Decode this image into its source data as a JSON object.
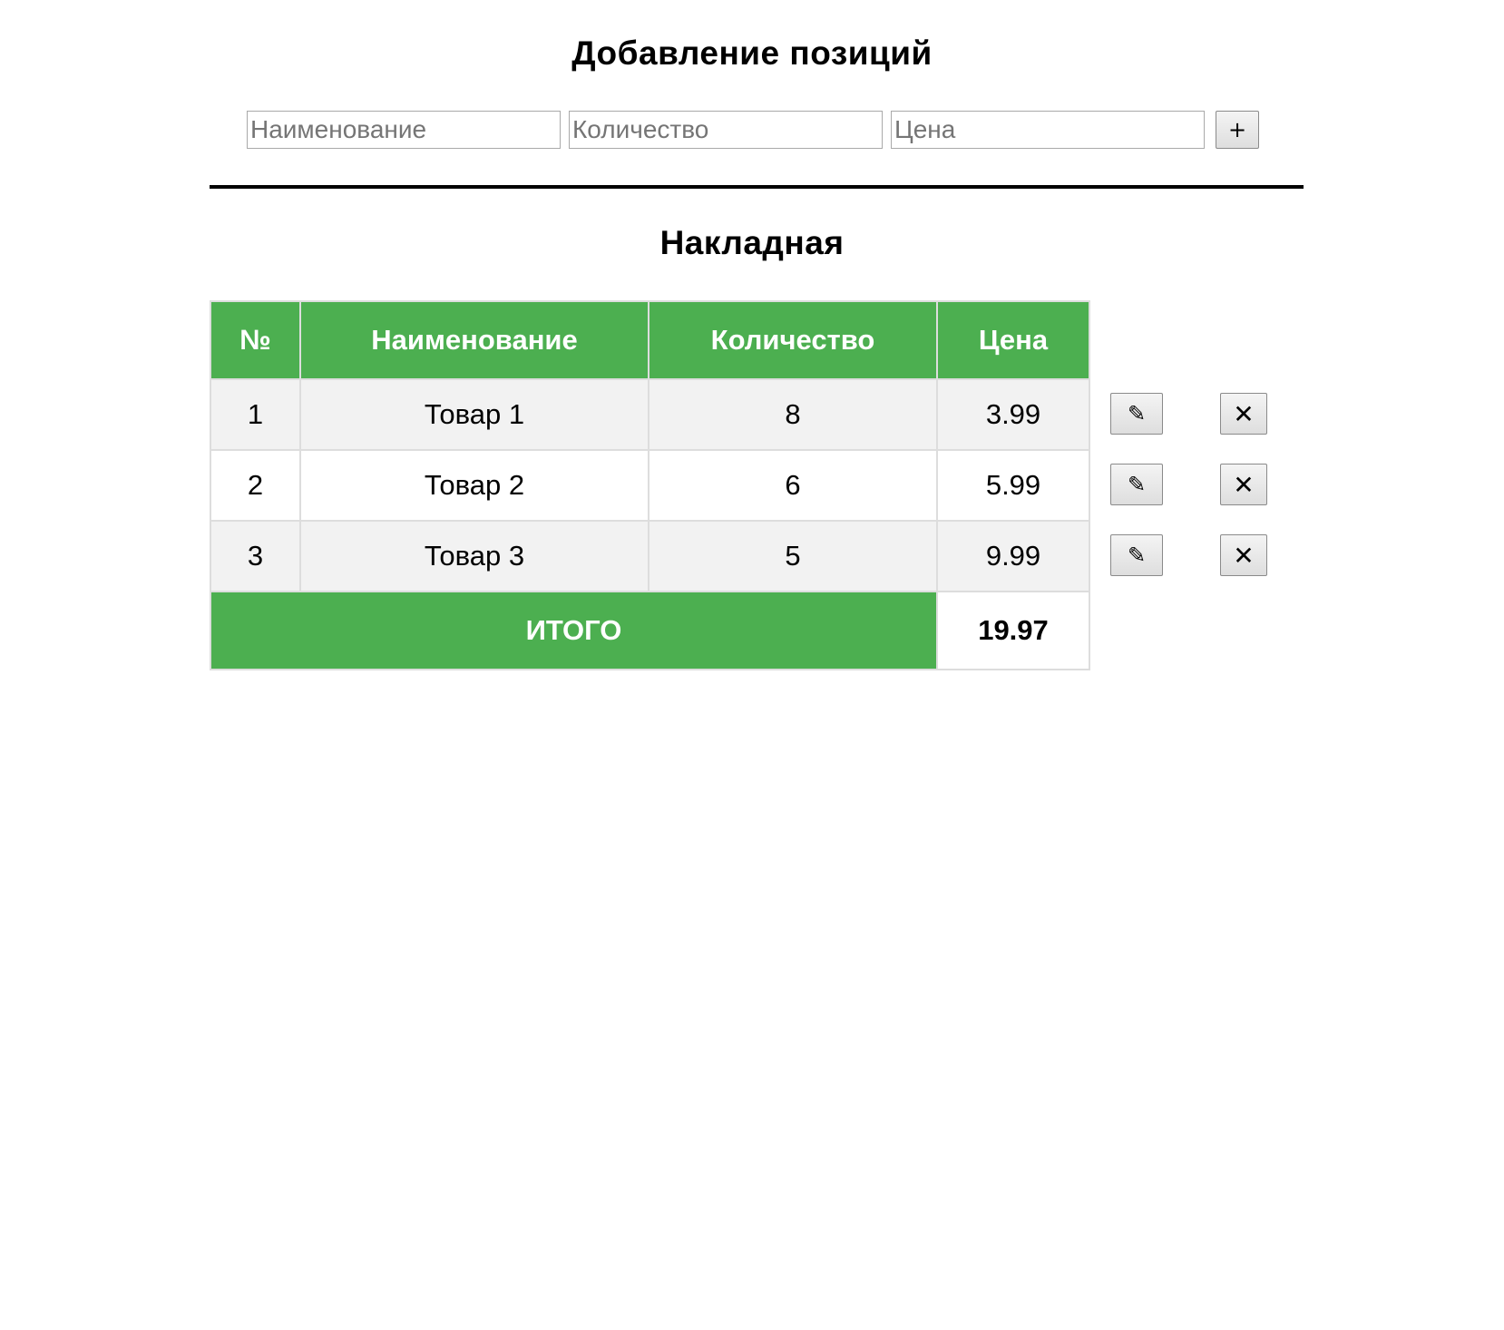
{
  "add_form": {
    "title": "Добавление позиций",
    "name_placeholder": "Наименование",
    "quantity_placeholder": "Количество",
    "price_placeholder": "Цена",
    "add_label": "+"
  },
  "invoice": {
    "title": "Накладная",
    "headers": [
      "№",
      "Наименование",
      "Количество",
      "Цена"
    ],
    "rows": [
      {
        "num": "1",
        "name": "Товар 1",
        "qty": "8",
        "price": "3.99"
      },
      {
        "num": "2",
        "name": "Товар 2",
        "qty": "6",
        "price": "5.99"
      },
      {
        "num": "3",
        "name": "Товар 3",
        "qty": "5",
        "price": "9.99"
      }
    ],
    "total_label": "ИТОГО",
    "total_value": "19.97"
  },
  "actions": {
    "edit_icon": "pencil-icon",
    "edit_glyph": "✎",
    "delete_icon": "close-icon",
    "delete_glyph": "✕"
  },
  "colors": {
    "accent": "#4caf50",
    "row_alt": "#f2f2f2",
    "border": "#dddddd"
  }
}
